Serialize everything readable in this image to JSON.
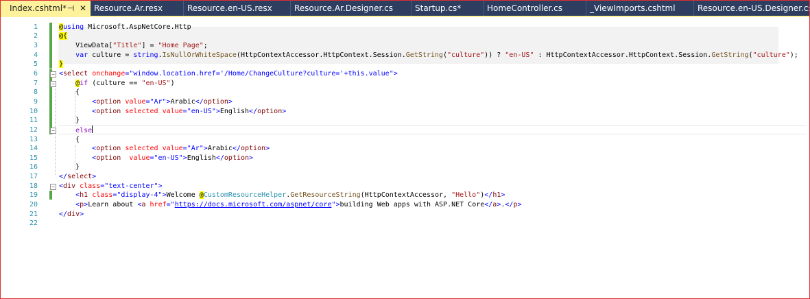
{
  "tabs": [
    {
      "label": "Index.cshtml*",
      "active": true
    },
    {
      "label": "Resource.Ar.resx"
    },
    {
      "label": "Resource.en-US.resx"
    },
    {
      "label": "Resource.Ar.Designer.cs"
    },
    {
      "label": "Startup.cs*"
    },
    {
      "label": "HomeController.cs"
    },
    {
      "label": "_ViewImports.cshtml"
    },
    {
      "label": "Resource.en-US.Designer.cs"
    }
  ],
  "tab_glyphs": {
    "pin": "⊣",
    "close": "✕"
  },
  "line_numbers": [
    "1",
    "2",
    "3",
    "4",
    "5",
    "6",
    "7",
    "8",
    "9",
    "10",
    "11",
    "12",
    "13",
    "14",
    "15",
    "16",
    "17",
    "18",
    "19",
    "20",
    "21",
    "22"
  ],
  "colors": {
    "tab_bar": "#2d3e60",
    "active_tab": "#fff29d",
    "line_number": "#2b91af",
    "change_bar": "#57a64a",
    "keyword": "#0000ff",
    "string": "#a31515",
    "tag": "#800000",
    "attribute": "#ff0000",
    "razor_marker": "#ffff00"
  },
  "code": {
    "l1": {
      "at": "@",
      "kw": "using",
      "ns": " Microsoft.AspNetCore.Http"
    },
    "l2": {
      "at": "@{"
    },
    "l3": {
      "a": "ViewData[",
      "s": "\"Title\"",
      "b": "] = ",
      "s2": "\"Home Page\"",
      "c": ";"
    },
    "l4": {
      "kw": "var",
      "a": " culture = ",
      "kw2": "string",
      "b": ".",
      "fn": "IsNullOrWhiteSpace",
      "c": "(HttpContextAccessor.HttpContext.Session.",
      "fn2": "GetString",
      "d": "(",
      "s": "\"culture\"",
      "e": ")) ? ",
      "s2": "\"en-US\"",
      "f": " : HttpContextAccessor.HttpContext.Session.",
      "fn3": "GetString",
      "g": "(",
      "s3": "\"culture\"",
      "h": ");"
    },
    "l5": {
      "at": "}"
    },
    "l6": {
      "lt": "<",
      "tag": "select",
      "sp": " ",
      "attr": "onchange",
      "eq": "=",
      "v1": "\"window.location.href='/Home/ChangeCulture?culture='+",
      "kw": "this",
      "v2": ".value\"",
      "gt": ">"
    },
    "l7": {
      "at": "@",
      "ctrl": "if",
      "a": " (culture == ",
      "s": "\"en-US\"",
      "b": ")"
    },
    "l8": {
      "a": "{"
    },
    "l9": {
      "lt": "<",
      "tag": "option",
      "sp": " ",
      "attr": "value",
      "eq": "=",
      "v": "\"Ar\"",
      "gt": ">",
      "text": "Arabic",
      "lt2": "</",
      "tag2": "option",
      "gt2": ">"
    },
    "l10": {
      "lt": "<",
      "tag": "option",
      "sp": " ",
      "attr": "selected",
      "sp2": " ",
      "attr2": "value",
      "eq": "=",
      "v": "\"en-US\"",
      "gt": ">",
      "text": "English",
      "lt2": "</",
      "tag2": "option",
      "gt2": ">"
    },
    "l11": {
      "a": "}"
    },
    "l12": {
      "ctrl": "else"
    },
    "l13": {
      "a": "{"
    },
    "l14": {
      "lt": "<",
      "tag": "option",
      "sp": " ",
      "attr": "selected",
      "sp2": " ",
      "attr2": "value",
      "eq": "=",
      "v": "\"Ar\"",
      "gt": ">",
      "text": "Arabic",
      "lt2": "</",
      "tag2": "option",
      "gt2": ">"
    },
    "l15": {
      "lt": "<",
      "tag": "option",
      "sp": "  ",
      "attr": "value",
      "eq": "=",
      "v": "\"en-US\"",
      "gt": ">",
      "text": "English",
      "lt2": "</",
      "tag2": "option",
      "gt2": ">"
    },
    "l16": {
      "a": "}"
    },
    "l17": {
      "lt": "</",
      "tag": "select",
      "gt": ">"
    },
    "l18": {
      "lt": "<",
      "tag": "div",
      "sp": " ",
      "attr": "class",
      "eq": "=",
      "v": "\"text-center\"",
      "gt": ">"
    },
    "l19": {
      "lt": "<",
      "tag": "h1",
      "sp": " ",
      "attr": "class",
      "eq": "=",
      "v": "\"display-4\"",
      "gt": ">",
      "text": "Welcome ",
      "at": "@",
      "typ": "CustomResourceHelper",
      "dot": ".",
      "fn": "GetResourceString",
      "a": "(HttpContextAccessor, ",
      "s": "\"Hello\"",
      "b": ")",
      "lt2": "</",
      "tag2": "h1",
      "gt2": ">"
    },
    "l20": {
      "lt": "<",
      "tag": "p",
      "gt": ">",
      "text": "Learn about ",
      "lt2": "<",
      "tag2": "a",
      "sp": " ",
      "attr": "href",
      "eq": "=",
      "q1": "\"",
      "url": "https://docs.microsoft.com/aspnet/core",
      "q2": "\"",
      "gt2": ">",
      "text2": "building Web apps with ASP.NET Core",
      "lt3": "</",
      "tag3": "a",
      "gt3": ">",
      "text3": ".",
      "lt4": "</",
      "tag4": "p",
      "gt4": ">"
    },
    "l21": {
      "lt": "</",
      "tag": "div",
      "gt": ">"
    }
  }
}
